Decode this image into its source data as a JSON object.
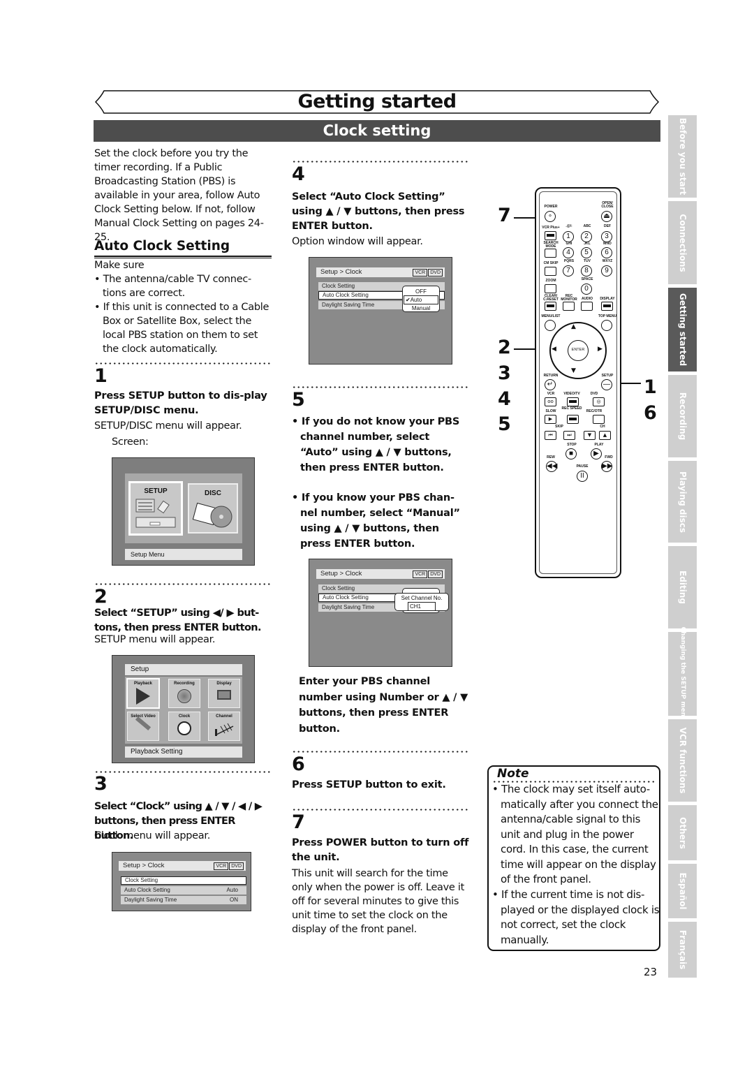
{
  "header": {
    "chapter_title": "Getting started",
    "section_title": "Clock setting"
  },
  "intro": {
    "paragraph": "Set the clock before you try the timer recording. If a Public Broadcasting Station (PBS) is available in your area, follow Auto Clock Setting below. If not, follow Manual Clock Setting on pages 24-25."
  },
  "auto_clock": {
    "heading": "Auto Clock Setting",
    "make_sure": "Make sure",
    "bullets": [
      "The antenna/cable TV connec-tions are correct.",
      "If this unit is connected to a Cable Box or Satellite Box, select the local PBS station on them to set the clock automatically."
    ]
  },
  "steps": [
    {
      "number": "1",
      "instruction": "Press SETUP button to dis-play SETUP/DISC menu.",
      "result": "SETUP/DISC menu will appear.",
      "screen_label": "Screen:",
      "screen": {
        "tiles": [
          "SETUP",
          "DISC"
        ],
        "status": "Setup Menu"
      }
    },
    {
      "number": "2",
      "instruction": "Select “SETUP” using ◀/ ▶ but-tons, then press ENTER button.",
      "result": "SETUP menu will appear.",
      "screen": {
        "title": "Setup",
        "tiles": [
          "Playback",
          "Recording",
          "Display",
          "Select Video",
          "Clock",
          "Channel"
        ],
        "status": "Playback Setting"
      }
    },
    {
      "number": "3",
      "instruction": "Select “Clock” using ▲ / ▼ / ◀ / ▶ buttons, then press ENTER button.",
      "result": "Clock menu will appear.",
      "screen": {
        "title": "Setup > Clock",
        "tags": [
          "VCR",
          "DVD"
        ],
        "rows": [
          {
            "label": "Clock Setting",
            "value": ""
          },
          {
            "label": "Auto Clock Setting",
            "value": "Auto"
          },
          {
            "label": "Daylight Saving Time",
            "value": "ON"
          }
        ]
      }
    },
    {
      "number": "4",
      "instruction": "Select “Auto Clock Setting” using ▲ / ▼ buttons, then press ENTER button.",
      "result": "Option window will appear.",
      "screen": {
        "title": "Setup > Clock",
        "tags": [
          "VCR",
          "DVD"
        ],
        "rows": [
          "Clock Setting",
          "Auto Clock Setting",
          "Daylight Saving Time"
        ],
        "options": [
          "OFF",
          "Auto",
          "Manual"
        ],
        "checked_option": "Auto"
      }
    },
    {
      "number": "5",
      "bullets": [
        "If you do not know your PBS channel number, select “Auto” using ▲ / ▼ buttons, then press ENTER button.",
        "If you know your PBS chan-nel number, select “Manual” using ▲ / ▼ buttons, then press ENTER button."
      ],
      "screen": {
        "title": "Setup > Clock",
        "tags": [
          "VCR",
          "DVD"
        ],
        "rows": [
          "Clock Setting",
          "Auto Clock Setting",
          "Daylight Saving Time"
        ],
        "popup_title": "Set Channel No.",
        "channel_value": "CH1"
      },
      "after": "Enter your PBS channel number using Number or ▲ / ▼ buttons, then press ENTER button."
    },
    {
      "number": "6",
      "instruction": "Press SETUP button to exit."
    },
    {
      "number": "7",
      "instruction": "Press POWER button to turn off the unit.",
      "result": "This unit will search for the time only when the power is off. Leave it off for several minutes to give this unit time to set the clock on the display of the front panel."
    }
  ],
  "remote": {
    "callouts_left": [
      "7",
      "2",
      "3",
      "4",
      "5"
    ],
    "callouts_right": [
      "1",
      "6"
    ],
    "labels": {
      "power": "POWER",
      "open_close": "OPEN/ CLOSE",
      "vcr_plus": "VCR Plus+",
      "k1": ".@/:",
      "k2": "ABC",
      "k3": "DEF",
      "search_mode": "SEARCH MODE",
      "k4": "GHI",
      "k5": "JKL",
      "k6": "MNO",
      "cm_skip": "CM SKIP",
      "k7": "PQRS",
      "k8": "TUV",
      "k9": "WXYZ",
      "zoom": "ZOOM",
      "k0": "SPACE",
      "clear": "CLEAR/ C.RESET",
      "rec_monitor": "REC MONITOR",
      "audio": "AUDIO",
      "display": "DISPLAY",
      "menu_list": "MENU/LIST",
      "top_menu": "TOP MENU",
      "enter": "ENTER",
      "return": "RETURN",
      "setup": "SETUP",
      "vcr": "VCR",
      "video_tv": "VIDEO/TV",
      "dvd": "DVD",
      "slow": "SLOW",
      "rec_speed": "REC SPEED",
      "rec_otr": "REC/OTR",
      "skip": "SKIP",
      "ch": "CH",
      "stop": "STOP",
      "play": "PLAY",
      "rew": "REW",
      "fwd": "FWD",
      "pause": "PAUSE"
    },
    "digits": [
      "1",
      "2",
      "3",
      "4",
      "5",
      "6",
      "7",
      "8",
      "9",
      "0"
    ]
  },
  "note": {
    "title": "Note",
    "bullets": [
      "The clock may set itself auto-matically after you connect the antenna/cable signal to this unit and plug in the power cord. In this case, the current time will appear on the display of the front panel.",
      "If the current time is not dis-played or the displayed clock is not correct, set the clock manually."
    ]
  },
  "side_tabs": [
    {
      "label": "Before you start",
      "active": false
    },
    {
      "label": "Connections",
      "active": false
    },
    {
      "label": "Getting started",
      "active": true
    },
    {
      "label": "Recording",
      "active": false
    },
    {
      "label": "Playing discs",
      "active": false
    },
    {
      "label": "Editing",
      "active": false
    },
    {
      "label": "Changing the SETUP menu",
      "active": false
    },
    {
      "label": "VCR functions",
      "active": false
    },
    {
      "label": "Others",
      "active": false
    },
    {
      "label": "Español",
      "active": false
    },
    {
      "label": "Français",
      "active": false
    }
  ],
  "page_number": "23"
}
